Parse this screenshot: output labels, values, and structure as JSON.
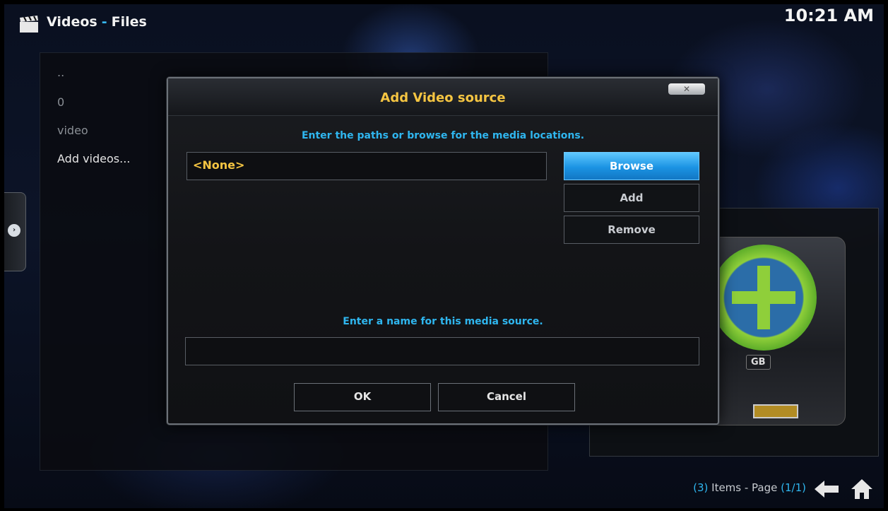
{
  "header": {
    "app_icon": "clapperboard-icon",
    "section": "Videos",
    "separator": "-",
    "view": "Files",
    "clock": "10:21 AM"
  },
  "file_list": {
    "items": [
      "..",
      "0",
      "video",
      "Add videos..."
    ]
  },
  "side_tab": {
    "icon": "chevron-right-icon",
    "glyph": "›"
  },
  "preview": {
    "icon": "add-source-drive-icon",
    "badge": "GB"
  },
  "dialog": {
    "title": "Add Video source",
    "close_glyph": "✕",
    "paths_prompt": "Enter the paths or browse for the media locations.",
    "path_value": "<None>",
    "browse_label": "Browse",
    "add_label": "Add",
    "remove_label": "Remove",
    "name_prompt": "Enter a name for this media source.",
    "name_value": "",
    "ok_label": "OK",
    "cancel_label": "Cancel"
  },
  "status": {
    "count_open": "(",
    "count": "3",
    "count_close": ")",
    "items_page_text": " Items - Page ",
    "page_open": "(",
    "page": "1/1",
    "page_close": ")"
  },
  "footer_icons": [
    "back-arrow-icon",
    "home-icon"
  ],
  "colors": {
    "accent_blue": "#2fb6ef",
    "title_gold": "#f5c542",
    "browse_blue": "#1b93e3"
  }
}
